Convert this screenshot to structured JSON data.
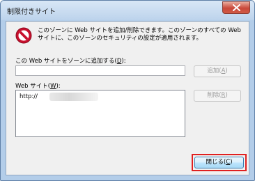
{
  "window": {
    "title": "制限付きサイト"
  },
  "message": {
    "text": "このゾーンに Web サイトを追加/削除できます。このゾーンのすべての Web サイトに、このゾーンのセキュリティの設定が適用されます。"
  },
  "add_section": {
    "label_prefix": "この Web サイトをゾーンに追加する(",
    "label_key": "D",
    "label_suffix": "):",
    "input_value": "",
    "add_button_prefix": "追加(",
    "add_button_key": "A",
    "add_button_suffix": ")"
  },
  "sites_section": {
    "label_prefix": "Web サイト(",
    "label_key": "W",
    "label_suffix": "):",
    "items": [
      "http://"
    ],
    "remove_button_prefix": "削除(",
    "remove_button_key": "R",
    "remove_button_suffix": ")"
  },
  "footer": {
    "close_button_prefix": "閉じる(",
    "close_button_key": "C",
    "close_button_suffix": ")"
  },
  "colors": {
    "highlight": "#e02020",
    "dialog_bg": "#f0f0f0",
    "frame": "#b3cde9"
  },
  "icons": {
    "warning": "no-entry-icon",
    "close": "close-icon"
  }
}
